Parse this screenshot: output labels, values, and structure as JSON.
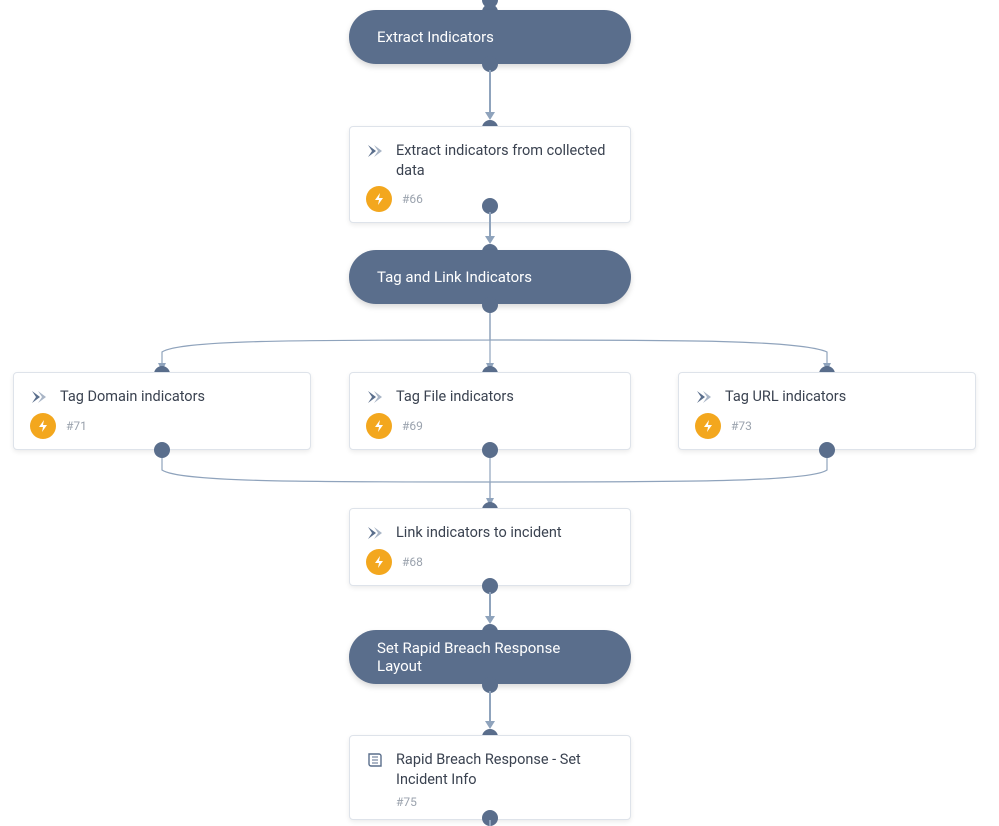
{
  "colors": {
    "node_fill": "#5a6e8c",
    "card_bg": "#ffffff",
    "card_border": "#dee3ea",
    "line": "#8fa3bc",
    "badge_automation": "#f3a71e",
    "badge_playbook": "#5a6e8c",
    "text_primary": "#3a4250",
    "text_muted": "#9aa2ad"
  },
  "sections": {
    "s1": {
      "label": "Extract Indicators"
    },
    "s2": {
      "label": "Tag and Link Indicators"
    },
    "s3": {
      "label": "Set Rapid Breach Response Layout"
    }
  },
  "tasks": {
    "t66": {
      "title": "Extract indicators from collected data",
      "id": "#66",
      "badge": "bolt"
    },
    "t71": {
      "title": "Tag Domain indicators",
      "id": "#71",
      "badge": "bolt"
    },
    "t69": {
      "title": "Tag File indicators",
      "id": "#69",
      "badge": "bolt"
    },
    "t73": {
      "title": "Tag URL indicators",
      "id": "#73",
      "badge": "bolt"
    },
    "t68": {
      "title": "Link indicators to incident",
      "id": "#68",
      "badge": "bolt"
    },
    "t75": {
      "title": "Rapid Breach Response - Set Incident Info",
      "id": "#75",
      "badge": "book"
    }
  }
}
